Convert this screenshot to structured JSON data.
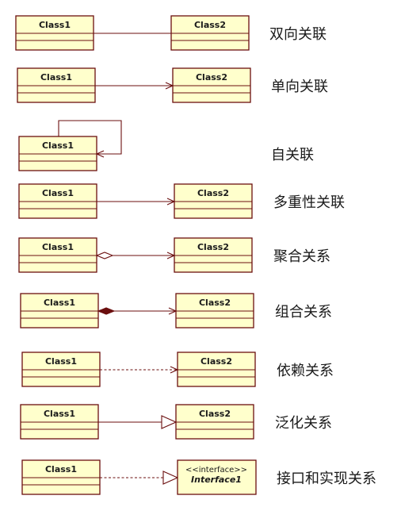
{
  "colors": {
    "class_fill": "#ffffcc",
    "class_stroke": "#6b0f0f",
    "connector": "#6b0f0f",
    "filled_diamond": "#6b0f0f",
    "label_text": "#1a1a1a",
    "background": "#ffffff"
  },
  "relations": [
    {
      "id": "bidirectional",
      "label": "双向关联",
      "source": "Class1",
      "target": "Class2",
      "line": "solid",
      "source_end": "none",
      "target_end": "none"
    },
    {
      "id": "unidirectional",
      "label": "单向关联",
      "source": "Class1",
      "target": "Class2",
      "line": "solid",
      "source_end": "none",
      "target_end": "open-arrow"
    },
    {
      "id": "self",
      "label": "自关联",
      "source": "Class1",
      "target": "Class1",
      "line": "solid",
      "source_end": "none",
      "target_end": "open-arrow"
    },
    {
      "id": "multiplicity",
      "label": "多重性关联",
      "source": "Class1",
      "target": "Class2",
      "line": "solid",
      "source_end": "none",
      "target_end": "open-arrow"
    },
    {
      "id": "aggregation",
      "label": "聚合关系",
      "source": "Class1",
      "target": "Class2",
      "line": "solid",
      "source_end": "hollow-diamond",
      "target_end": "open-arrow"
    },
    {
      "id": "composition",
      "label": "组合关系",
      "source": "Class1",
      "target": "Class2",
      "line": "solid",
      "source_end": "filled-diamond",
      "target_end": "open-arrow"
    },
    {
      "id": "dependency",
      "label": "依赖关系",
      "source": "Class1",
      "target": "Class2",
      "line": "dashed",
      "source_end": "none",
      "target_end": "open-arrow"
    },
    {
      "id": "generalization",
      "label": "泛化关系",
      "source": "Class1",
      "target": "Class2",
      "line": "solid",
      "source_end": "none",
      "target_end": "hollow-triangle"
    },
    {
      "id": "realization",
      "label": "接口和实现关系",
      "source": "Class1",
      "target": "Interface1",
      "target_stereotype": "<<interface>>",
      "line": "dashed",
      "source_end": "none",
      "target_end": "hollow-triangle"
    }
  ]
}
